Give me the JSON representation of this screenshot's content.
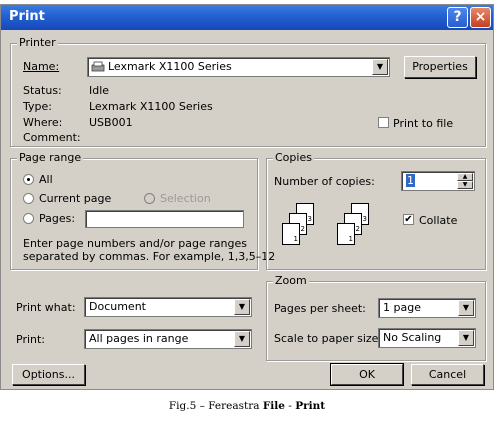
{
  "window": {
    "title": "Print",
    "help": "?",
    "close": "×"
  },
  "printer": {
    "legend": "Printer",
    "name_label": "Name:",
    "name_value": "Lexmark X1100 Series",
    "properties_button": "Properties",
    "status_label": "Status:",
    "status_value": "Idle",
    "type_label": "Type:",
    "type_value": "Lexmark X1100 Series",
    "where_label": "Where:",
    "where_value": "USB001",
    "comment_label": "Comment:",
    "print_to_file": "Print to file"
  },
  "page_range": {
    "legend": "Page range",
    "all": "All",
    "current_page": "Current page",
    "selection": "Selection",
    "pages": "Pages:",
    "pages_value": "",
    "hint_line1": "Enter page numbers and/or page ranges",
    "hint_line2": "separated by commas.  For example, 1,3,5–12"
  },
  "copies": {
    "legend": "Copies",
    "number_label": "Number of copies:",
    "number_value": "1",
    "collate": "Collate",
    "page_numbers": [
      "3",
      "2",
      "1"
    ]
  },
  "print_what": {
    "label": "Print what:",
    "value": "Document"
  },
  "print": {
    "label": "Print:",
    "value": "All pages in range"
  },
  "zoom": {
    "legend": "Zoom",
    "pages_per_sheet_label": "Pages per sheet:",
    "pages_per_sheet_value": "1 page",
    "scale_label": "Scale to paper size:",
    "scale_value": "No Scaling"
  },
  "buttons": {
    "options": "Options...",
    "ok": "OK",
    "cancel": "Cancel"
  },
  "caption": {
    "prefix": "Fig.5 – Fereastra ",
    "file": "File",
    "dash": " - ",
    "print": "Print"
  }
}
